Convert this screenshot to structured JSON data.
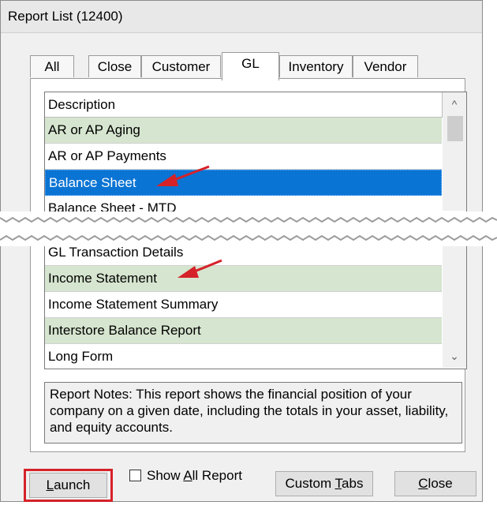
{
  "window": {
    "title": "Report List (12400)"
  },
  "tabs": [
    {
      "label": "All"
    },
    {
      "label": "Close"
    },
    {
      "label": "Customer"
    },
    {
      "label": "GL"
    },
    {
      "label": "Inventory"
    },
    {
      "label": "Vendor"
    }
  ],
  "active_tab": "GL",
  "list": {
    "header": "Description",
    "rows_top": [
      {
        "label": "AR or AP Aging",
        "style": "green"
      },
      {
        "label": "AR or AP Payments",
        "style": "white"
      },
      {
        "label": "Balance Sheet",
        "style": "selected"
      },
      {
        "label": "Balance Sheet - MTD",
        "style": "white"
      }
    ],
    "rows_bottom": [
      {
        "label": "GL Transaction Details",
        "style": "white"
      },
      {
        "label": "Income Statement",
        "style": "green"
      },
      {
        "label": "Income Statement Summary",
        "style": "white"
      },
      {
        "label": "Interstore Balance Report",
        "style": "green"
      },
      {
        "label": "Long Form",
        "style": "white"
      }
    ]
  },
  "notes": "Report Notes:  This report shows the financial position of your company on a given date, including the totals in your asset, liability, and equity accounts.",
  "buttons": {
    "launch": {
      "u": "L",
      "rest": "aunch"
    },
    "show_all": {
      "pre": "Show ",
      "u": "A",
      "post": "ll Report"
    },
    "custom_tabs": {
      "pre": "Custom ",
      "u": "T",
      "post": "abs"
    },
    "close": {
      "u": "C",
      "rest": "lose"
    }
  },
  "colors": {
    "green_row": "#d6e5cf",
    "selected_row": "#0a74d4",
    "annotation_red": "#d52229"
  }
}
